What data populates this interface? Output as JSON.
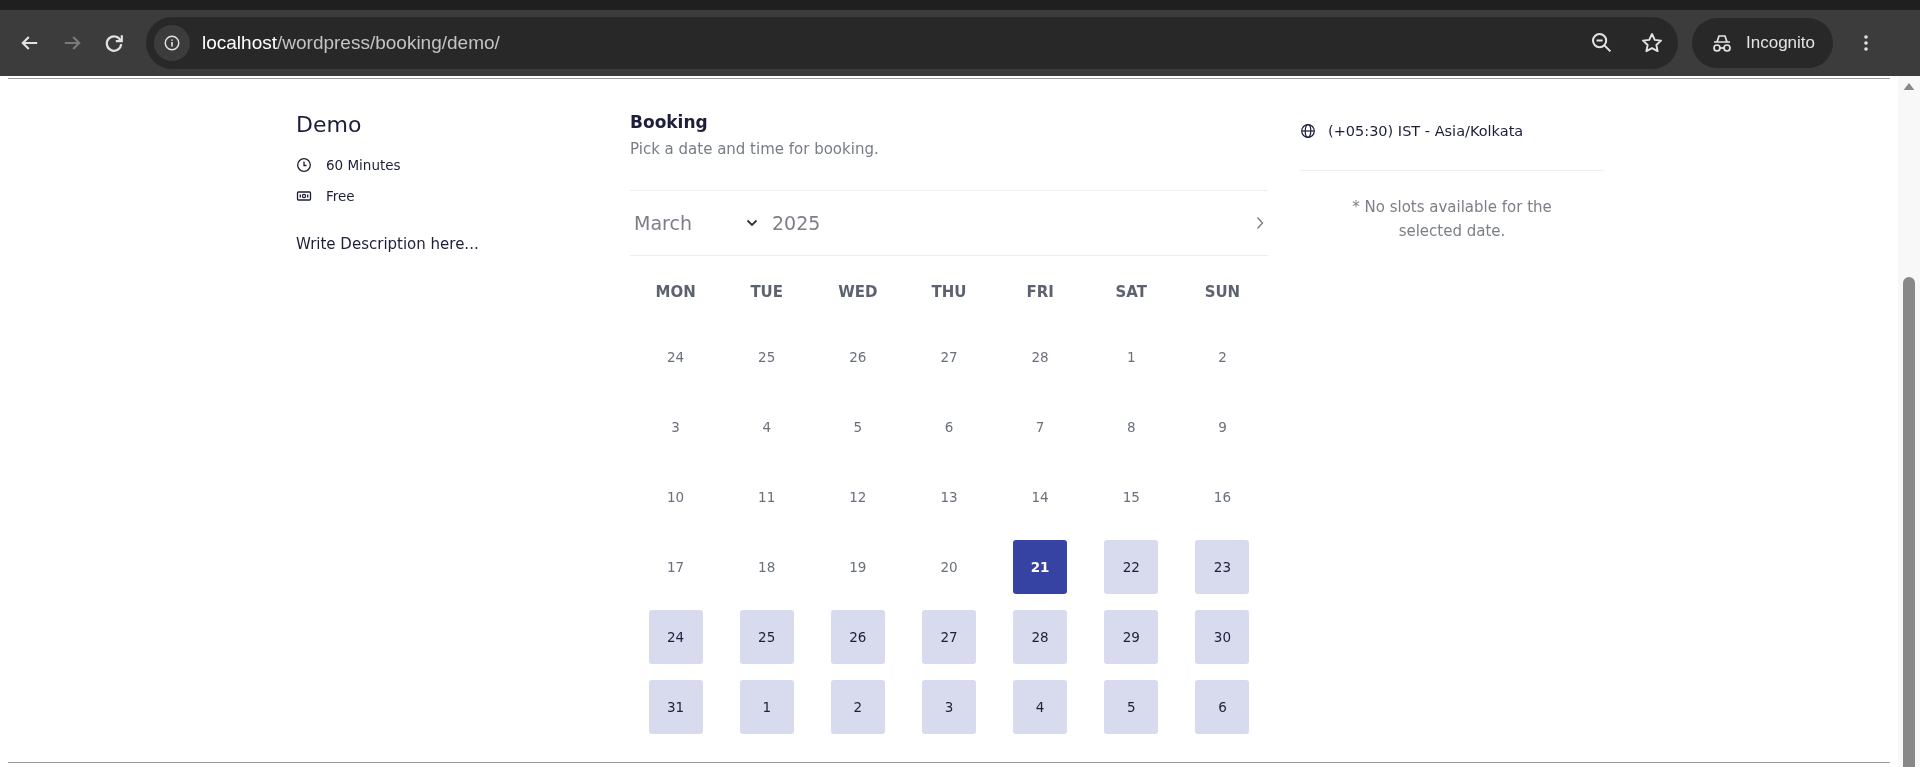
{
  "browser": {
    "url_host": "localhost",
    "url_path": "/wordpress/booking/demo/",
    "profile": "Incognito"
  },
  "event": {
    "title": "Demo",
    "duration": "60 Minutes",
    "price": "Free",
    "description": "Write Description here..."
  },
  "booking": {
    "title": "Booking",
    "subtitle": "Pick a date and time for booking.",
    "month": "March",
    "year": "2025",
    "weekdays": [
      "MON",
      "TUE",
      "WED",
      "THU",
      "FRI",
      "SAT",
      "SUN"
    ],
    "days": [
      {
        "label": "24",
        "available": false,
        "selected": false
      },
      {
        "label": "25",
        "available": false,
        "selected": false
      },
      {
        "label": "26",
        "available": false,
        "selected": false
      },
      {
        "label": "27",
        "available": false,
        "selected": false
      },
      {
        "label": "28",
        "available": false,
        "selected": false
      },
      {
        "label": "1",
        "available": false,
        "selected": false
      },
      {
        "label": "2",
        "available": false,
        "selected": false
      },
      {
        "label": "3",
        "available": false,
        "selected": false
      },
      {
        "label": "4",
        "available": false,
        "selected": false
      },
      {
        "label": "5",
        "available": false,
        "selected": false
      },
      {
        "label": "6",
        "available": false,
        "selected": false
      },
      {
        "label": "7",
        "available": false,
        "selected": false
      },
      {
        "label": "8",
        "available": false,
        "selected": false
      },
      {
        "label": "9",
        "available": false,
        "selected": false
      },
      {
        "label": "10",
        "available": false,
        "selected": false
      },
      {
        "label": "11",
        "available": false,
        "selected": false
      },
      {
        "label": "12",
        "available": false,
        "selected": false
      },
      {
        "label": "13",
        "available": false,
        "selected": false
      },
      {
        "label": "14",
        "available": false,
        "selected": false
      },
      {
        "label": "15",
        "available": false,
        "selected": false
      },
      {
        "label": "16",
        "available": false,
        "selected": false
      },
      {
        "label": "17",
        "available": false,
        "selected": false
      },
      {
        "label": "18",
        "available": false,
        "selected": false
      },
      {
        "label": "19",
        "available": false,
        "selected": false
      },
      {
        "label": "20",
        "available": false,
        "selected": false
      },
      {
        "label": "21",
        "available": true,
        "selected": true
      },
      {
        "label": "22",
        "available": true,
        "selected": false
      },
      {
        "label": "23",
        "available": true,
        "selected": false
      },
      {
        "label": "24",
        "available": true,
        "selected": false
      },
      {
        "label": "25",
        "available": true,
        "selected": false
      },
      {
        "label": "26",
        "available": true,
        "selected": false
      },
      {
        "label": "27",
        "available": true,
        "selected": false
      },
      {
        "label": "28",
        "available": true,
        "selected": false
      },
      {
        "label": "29",
        "available": true,
        "selected": false
      },
      {
        "label": "30",
        "available": true,
        "selected": false
      },
      {
        "label": "31",
        "available": true,
        "selected": false
      },
      {
        "label": "1",
        "available": true,
        "selected": false
      },
      {
        "label": "2",
        "available": true,
        "selected": false
      },
      {
        "label": "3",
        "available": true,
        "selected": false
      },
      {
        "label": "4",
        "available": true,
        "selected": false
      },
      {
        "label": "5",
        "available": true,
        "selected": false
      },
      {
        "label": "6",
        "available": true,
        "selected": false
      }
    ]
  },
  "slots": {
    "timezone": "(+05:30) IST - Asia/Kolkata",
    "message": "* No slots available for the selected date."
  }
}
